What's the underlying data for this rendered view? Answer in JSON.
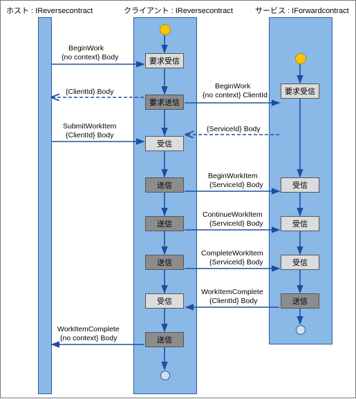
{
  "headers": {
    "host": "ホスト : IReversecontract",
    "client": "クライアント : IReversecontract",
    "service": "サービス : IForwardcontract"
  },
  "boxes": {
    "c1": "要求受信",
    "c2": "要求送信",
    "c3": "受信",
    "c4": "送信",
    "c5": "送信",
    "c6": "送信",
    "c7": "受信",
    "c8": "送信",
    "s1": "要求受信",
    "s2": "受信",
    "s3": "受信",
    "s4": "受信",
    "s5": "送信"
  },
  "messages": {
    "m1a": "BeginWork",
    "m1b": "{no context} Body",
    "m2a": "{ClientId} Body",
    "m3a": "SubmitWorkItem",
    "m3b": "{ClientId} Body",
    "m4a": "BeginWork",
    "m4b": "{no context} ClientId",
    "m5a": "{ServiceId} Body",
    "m6a": "BeginWorkItem",
    "m6b": "{ServiceId} Body",
    "m7a": "ContinueWorkItem",
    "m7b": "{ServiceId} Body",
    "m8a": "CompleteWorkItem",
    "m8b": "{ServiceId} Body",
    "m9a": "WorkItemComplete",
    "m9b": "{ClientId} Body",
    "m10a": "WorkItemComplete",
    "m10b": "{no context} Body"
  }
}
